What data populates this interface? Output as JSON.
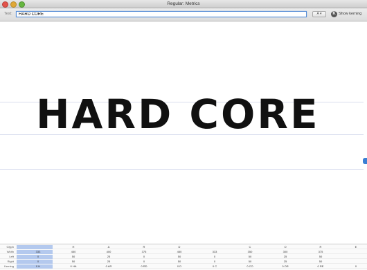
{
  "window": {
    "title": "Regular: Metrics"
  },
  "toolbar": {
    "text_label": "Text:",
    "text_value": "HARD CORE",
    "stepper_label": "A ▾",
    "kern_button_label": "K",
    "show_kerning_label": "Show kerning"
  },
  "preview": {
    "text": "HARD CORE"
  },
  "metrics": {
    "row_labels": [
      "Glyph",
      "Width",
      "Left",
      "Right",
      "Kerning"
    ],
    "glyphs": [
      "",
      "H",
      "A",
      "R",
      "D",
      "",
      "C",
      "O",
      "R",
      "E"
    ],
    "widths": [
      "333",
      "450",
      "400",
      "375",
      "450",
      "333",
      "350",
      "300",
      "375",
      ""
    ],
    "lefts": [
      "0",
      "50",
      "25",
      "0",
      "50",
      "0",
      "50",
      "25",
      "50",
      ""
    ],
    "rights": [
      "0",
      "50",
      "25",
      "0",
      "50",
      "0",
      "50",
      "25",
      "50",
      ""
    ],
    "kernings": [
      "0 H",
      "0 HA",
      "0 AR",
      "0 RD",
      "0 D",
      "0 C",
      "0 CO",
      "0 OR",
      "0 RE",
      "0"
    ]
  }
}
